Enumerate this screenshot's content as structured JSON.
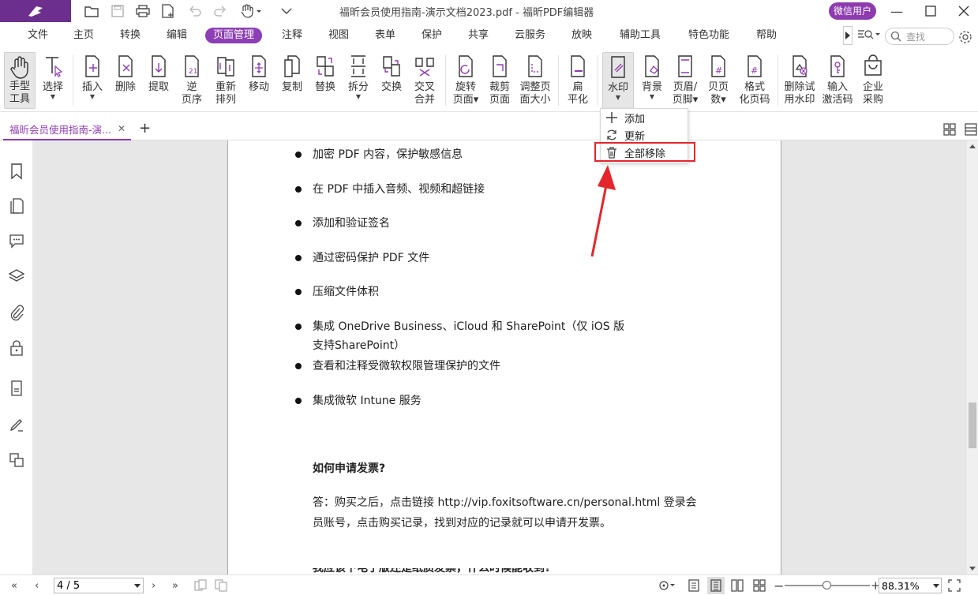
{
  "window": {
    "title": "福昕会员使用指南-演示文档2023.pdf - 福昕PDF编辑器",
    "user_badge": "微信用户"
  },
  "menu": {
    "items": [
      "文件",
      "主页",
      "转换",
      "编辑",
      "页面管理",
      "注释",
      "视图",
      "表单",
      "保护",
      "共享",
      "云服务",
      "放映",
      "辅助工具",
      "特色功能",
      "帮助"
    ],
    "active": "页面管理",
    "search_placeholder": "查找"
  },
  "ribbon": {
    "hand": [
      "手型",
      "工具"
    ],
    "select": "选择",
    "insert": "插入",
    "delete": "删除",
    "extract": "提取",
    "reverse": [
      "逆",
      "页序"
    ],
    "rearrange": [
      "重新",
      "排列"
    ],
    "move": "移动",
    "copy": "复制",
    "replace": "替换",
    "split": "拆分",
    "swap": "交换",
    "interleave": [
      "交叉",
      "合并"
    ],
    "rotate": [
      "旋转",
      "页面"
    ],
    "crop": [
      "裁剪",
      "页面"
    ],
    "resize": [
      "调整页",
      "面大小"
    ],
    "flatten": [
      "扁",
      "平化"
    ],
    "watermark": "水印",
    "background": "背景",
    "header_footer": [
      "页眉/",
      "页脚"
    ],
    "page_number": [
      "贝页",
      "数"
    ],
    "format_page_number": [
      "格式",
      "化页码"
    ],
    "remove_trial_watermark": [
      "删除试",
      "用水印"
    ],
    "activation_code": [
      "输入",
      "激活码"
    ],
    "enterprise_purchase": [
      "企业",
      "采购"
    ]
  },
  "watermark_menu": {
    "add": "添加",
    "update": "更新",
    "remove_all": "全部移除"
  },
  "tab": {
    "label": "福昕会员使用指南-演..."
  },
  "document": {
    "bullets": [
      "加密 PDF 内容，保护敏感信息",
      "在 PDF 中插入音频、视频和超链接",
      "添加和验证签名",
      "通过密码保护 PDF 文件",
      "压缩文件体积",
      "集成 OneDrive Business、iCloud 和 SharePoint（仅 iOS 版",
      "查看和注释受微软权限管理保护的文件",
      "集成微软 Intune 服务"
    ],
    "bullet_continuation": "支持SharePoint）",
    "heading": "如何申请发票?",
    "answer_line1": "答：购买之后，点击链接 http://vip.foxitsoftware.cn/personal.html 登录会",
    "answer_line2": "员账号，点击购买记录，找到对应的记录就可以申请开发票。",
    "cut_line": "我应该下电子版还是纸质发票，什么时候能收到?"
  },
  "status": {
    "page": "4 / 5",
    "zoom": "88.31%",
    "zoom_level": 0.5
  },
  "colors": {
    "brand": "#8e3bb0",
    "highlight": "#e3262b"
  }
}
